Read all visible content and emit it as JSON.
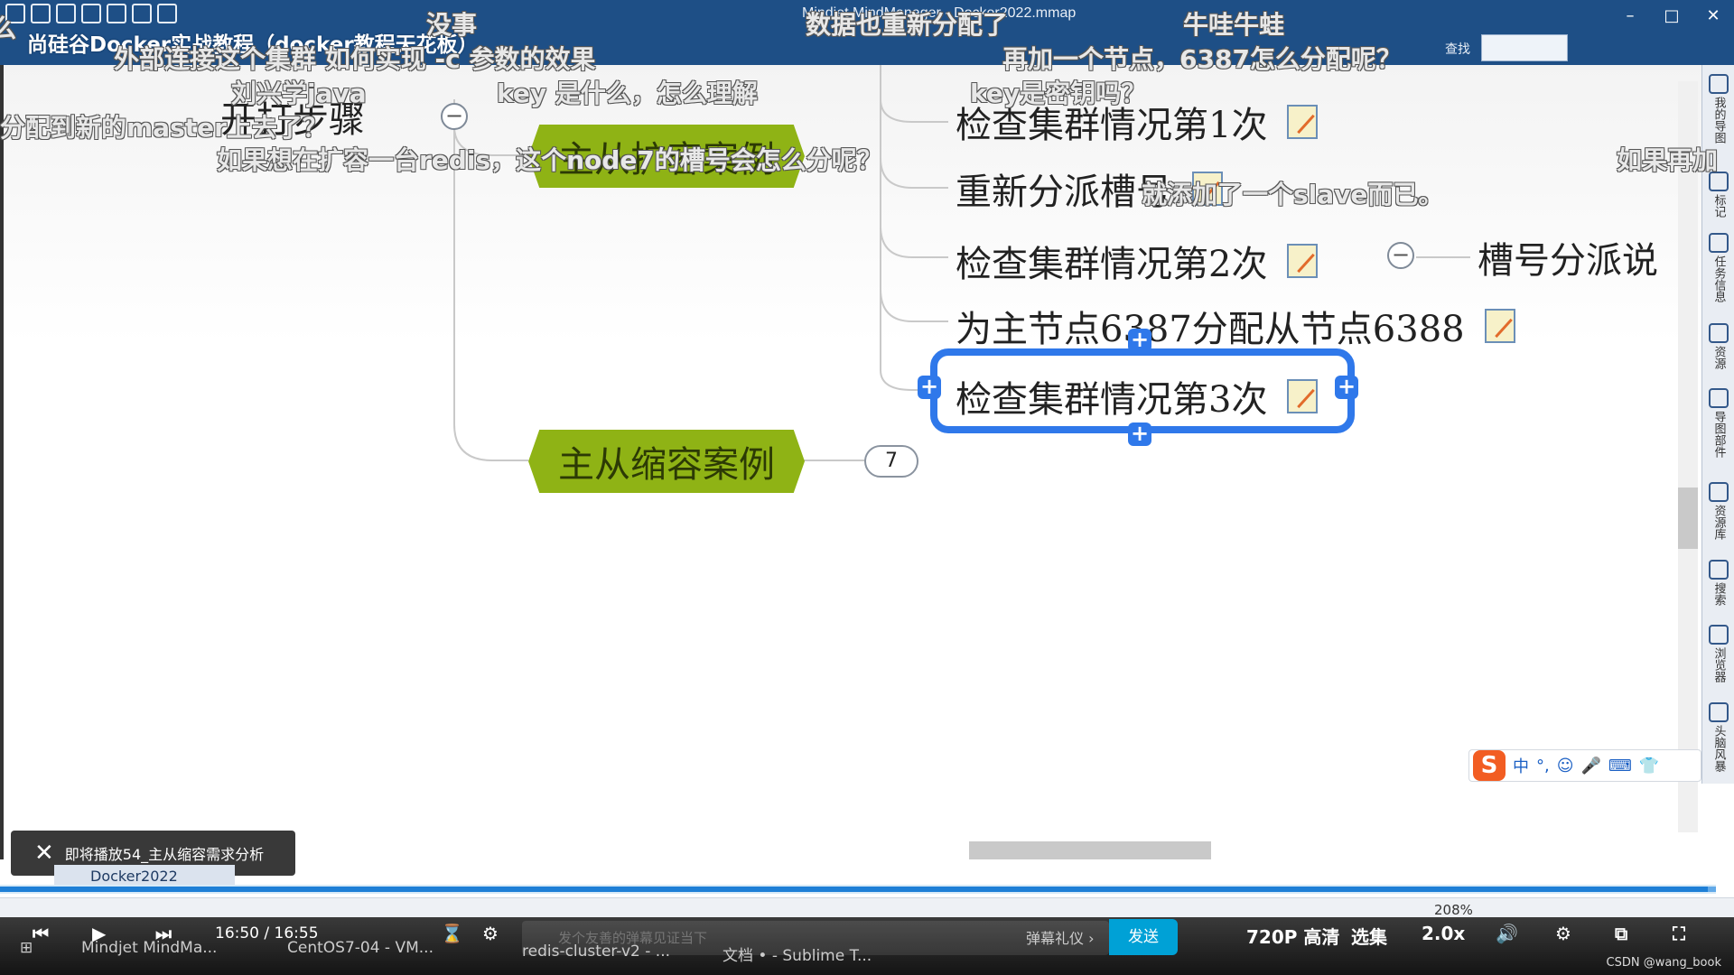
{
  "window": {
    "file_title": "Mindjet MindManager - Docker2022.mmap",
    "course_title": "尚硅谷Docker实战教程（docker教程天花板）",
    "search_label": "查找"
  },
  "side_panel": [
    "我的导图",
    "标记",
    "任务信息",
    "资源",
    "导图部件",
    "资源库",
    "搜索",
    "浏览器",
    "头脑风暴"
  ],
  "mindmap": {
    "root_partial": "开打步骤",
    "main_topics": [
      {
        "label": "主从扩容案例"
      },
      {
        "label": "主从缩容案例",
        "collapsed_count": "7"
      }
    ],
    "subtopics": [
      "检查集群情况第1次",
      "重新分派槽号",
      "检查集群情况第2次",
      "为主节点6387分配从节点6388",
      "检查集群情况第3次"
    ],
    "side_topic": "槽号分派说",
    "collapse_symbol": "−",
    "expand_symbol": "+"
  },
  "danmaku": [
    "没事",
    "数据也重新分配了",
    "牛哇牛蛙",
    "外部连接这个集群  如何实现 -c 参数的效果",
    "再加一个节点，6387怎么分配呢？",
    "刘兴学java",
    "key  是什么，怎么理解",
    "key是密钥吗？",
    "分配到新的master上去了？",
    "如果想在扩容一台redis，这个node7的槽号会怎么分呢？",
    "如果再加",
    "就添加了一个slave而已。"
  ],
  "ime": {
    "logo": "S",
    "items": [
      "中",
      "°,",
      "☺",
      "🎤",
      "⌨",
      "👕"
    ]
  },
  "up_next": {
    "text": "即将播放54_主从缩容需求分析",
    "close": "✕"
  },
  "doc_tab": "Docker2022",
  "status": {
    "zoom": "208%"
  },
  "player": {
    "current_time": "16:50",
    "separator": "/",
    "duration": "16:55",
    "progress": 0.995,
    "danmaku_placeholder": "发个友善的弹幕见证当下",
    "etiquette": "弹幕礼仪 ›",
    "send": "发送",
    "quality": "720P 高清",
    "episodes": "选集",
    "speed": "2.0x"
  },
  "taskbar": [
    "Mindjet MindMa...",
    "CentOS7-04 - VM...",
    "redis-cluster-v2 - ...",
    "文档 • - Sublime T..."
  ],
  "watermark": "CSDN @wang_book",
  "colors": {
    "main_topic": "#8fb315",
    "selection": "#2f78ea",
    "titlebar": "#1e4f86",
    "send": "#00a1d6"
  }
}
